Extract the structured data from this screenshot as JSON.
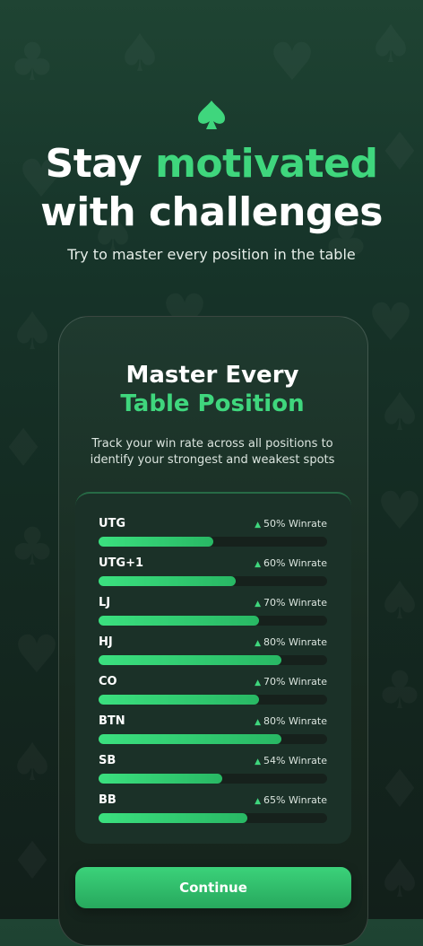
{
  "headline": {
    "line1_plain": "Stay ",
    "line1_accent": "motivated",
    "line2": "with challenges"
  },
  "subtitle": "Try to master every position in the table",
  "card": {
    "title_line1": "Master Every",
    "title_line2": "Table Position",
    "description": "Track your win rate across all positions to identify your strongest and weakest spots"
  },
  "positions": [
    {
      "name": "UTG",
      "rate_label": "50% Winrate",
      "winrate": 0.5
    },
    {
      "name": "UTG+1",
      "rate_label": "60% Winrate",
      "winrate": 0.6
    },
    {
      "name": "LJ",
      "rate_label": "70% Winrate",
      "winrate": 0.7
    },
    {
      "name": "HJ",
      "rate_label": "80% Winrate",
      "winrate": 0.8
    },
    {
      "name": "CO",
      "rate_label": "70% Winrate",
      "winrate": 0.7
    },
    {
      "name": "BTN",
      "rate_label": "80% Winrate",
      "winrate": 0.8
    },
    {
      "name": "SB",
      "rate_label": "54% Winrate",
      "winrate": 0.54
    },
    {
      "name": "BB",
      "rate_label": "65% Winrate",
      "winrate": 0.65
    }
  ],
  "continue_label": "Continue",
  "colors": {
    "accent": "#3fd67d",
    "background": "#17352a",
    "track": "#16211c"
  },
  "icons": {
    "logo": "spade-icon",
    "trend": "triangle-up-icon"
  }
}
